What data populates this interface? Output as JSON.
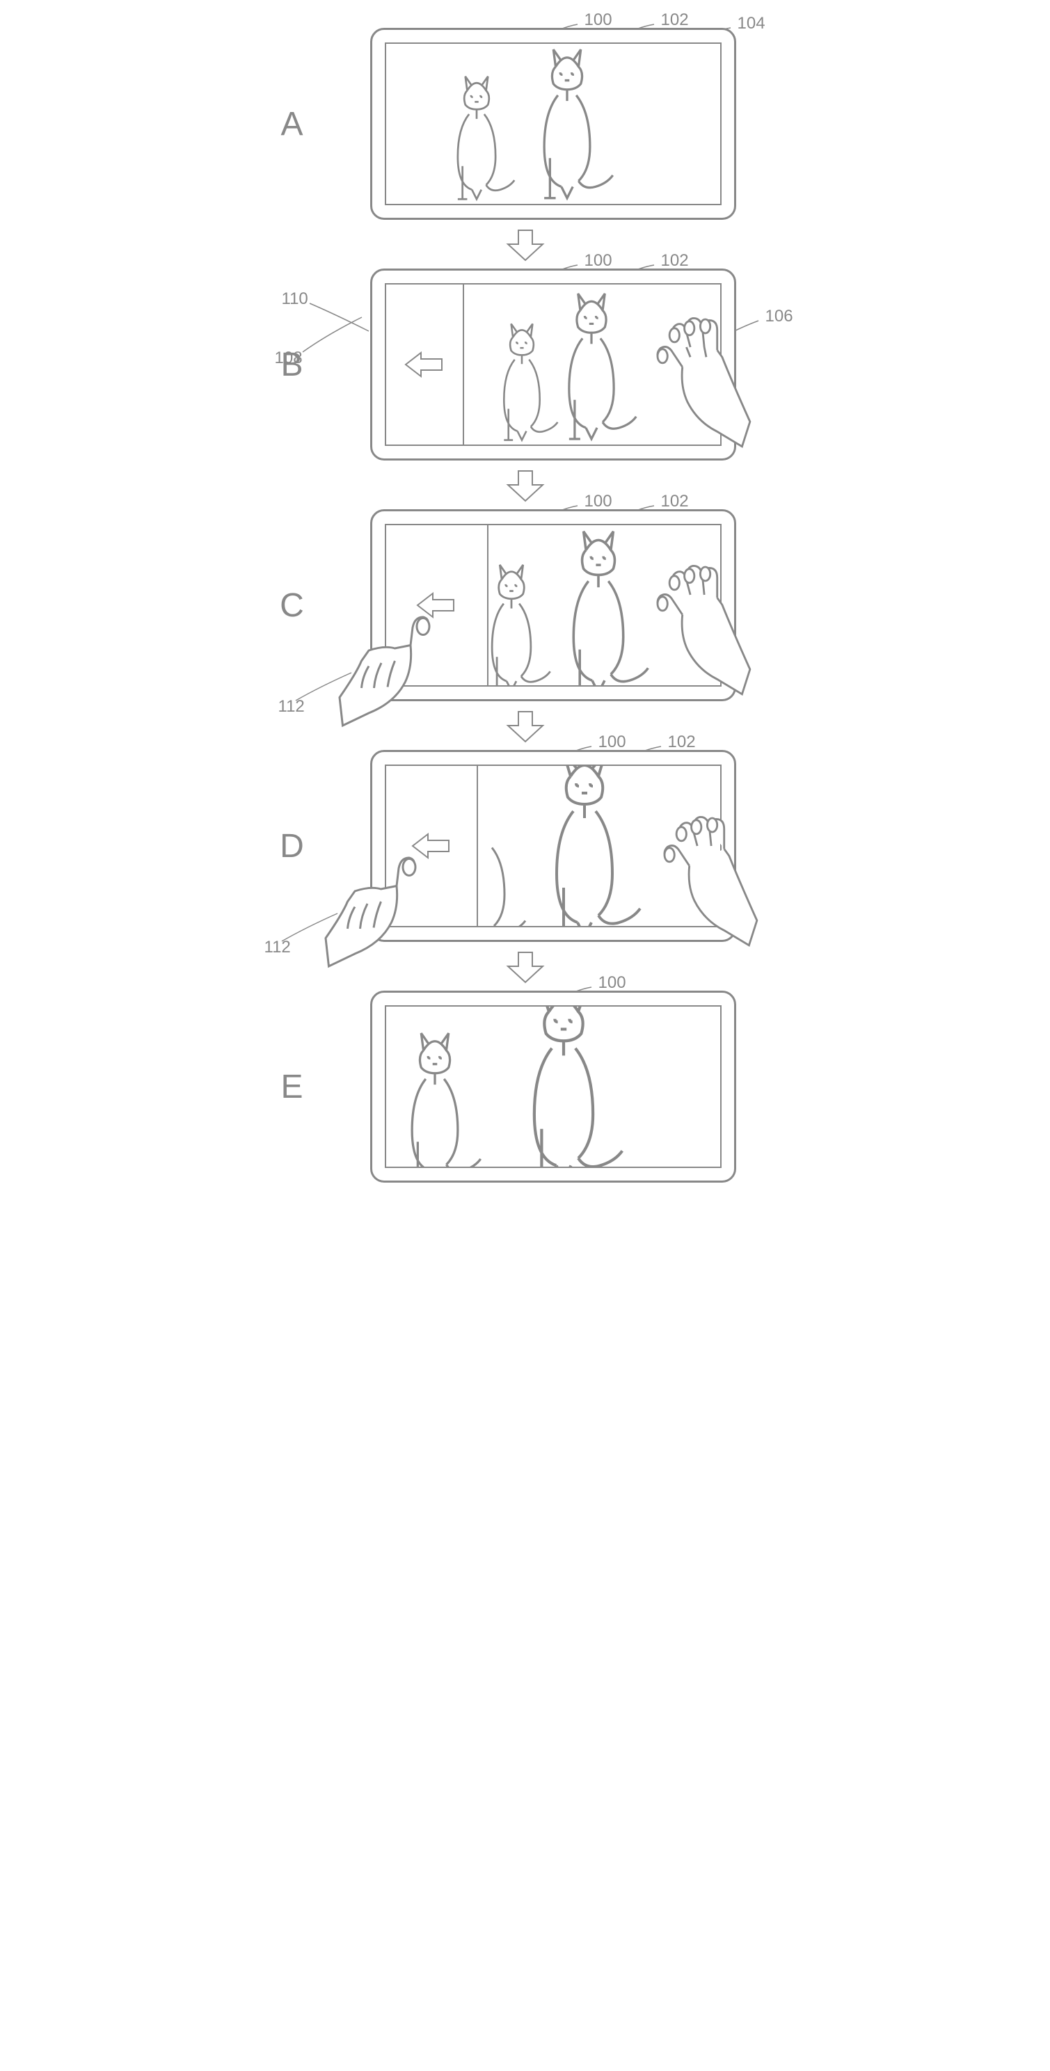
{
  "diagram": {
    "type": "patent-figure",
    "description": "Sequence of touch gestures on a tablet device showing image manipulation",
    "steps": [
      {
        "label": "A",
        "callouts": [
          {
            "ref": "100"
          },
          {
            "ref": "102"
          },
          {
            "ref": "104"
          }
        ]
      },
      {
        "label": "B",
        "callouts": [
          {
            "ref": "100"
          },
          {
            "ref": "102"
          },
          {
            "ref": "106"
          },
          {
            "ref": "108"
          },
          {
            "ref": "110"
          }
        ]
      },
      {
        "label": "C",
        "callouts": [
          {
            "ref": "100"
          },
          {
            "ref": "102"
          },
          {
            "ref": "112"
          }
        ]
      },
      {
        "label": "D",
        "callouts": [
          {
            "ref": "100"
          },
          {
            "ref": "102"
          },
          {
            "ref": "112"
          }
        ]
      },
      {
        "label": "E",
        "callouts": [
          {
            "ref": "100"
          }
        ]
      }
    ],
    "refs": {
      "100": "image/content",
      "102": "screen/display-area",
      "104": "device",
      "106": "multi-touch-hand-right",
      "108": "side-panel-region",
      "110": "direction-arrow",
      "112": "touch-hand-left"
    }
  }
}
